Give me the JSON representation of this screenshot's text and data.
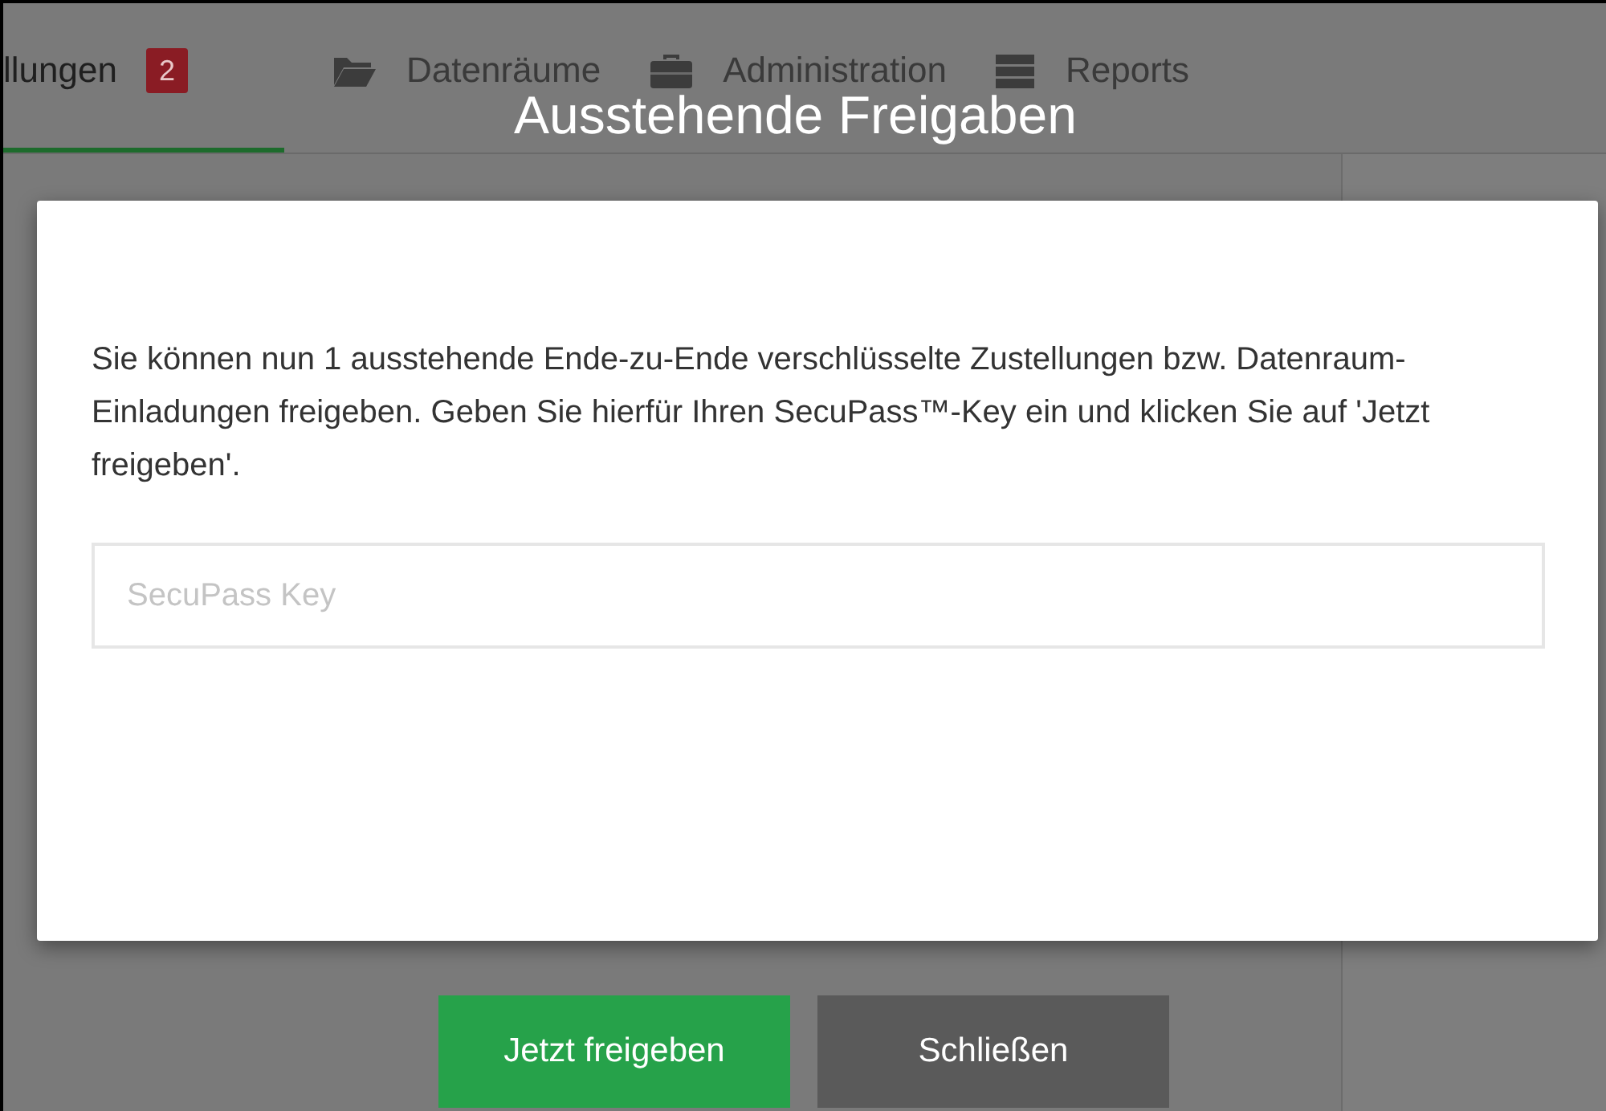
{
  "nav": {
    "tabs": [
      {
        "label": "llungen",
        "badge": "2",
        "selected": true
      },
      {
        "label": "Datenräume",
        "selected": false
      },
      {
        "label": "Administration",
        "selected": false
      },
      {
        "label": "Reports",
        "selected": false
      }
    ]
  },
  "dialog": {
    "title": "Ausstehende Freigaben",
    "message": "Sie können nun 1 ausstehende Ende-zu-Ende verschlüsselte Zustellungen bzw. Datenraum-Einladungen freigeben. Geben Sie hierfür Ihren SecuPass™-Key ein und klicken Sie auf 'Jetzt freigeben'.",
    "input": {
      "placeholder": "SecuPass Key"
    },
    "buttons": [
      {
        "label": "Jetzt freigeben",
        "kind": "primary"
      },
      {
        "label": "Schließen",
        "kind": "secondary"
      }
    ]
  }
}
